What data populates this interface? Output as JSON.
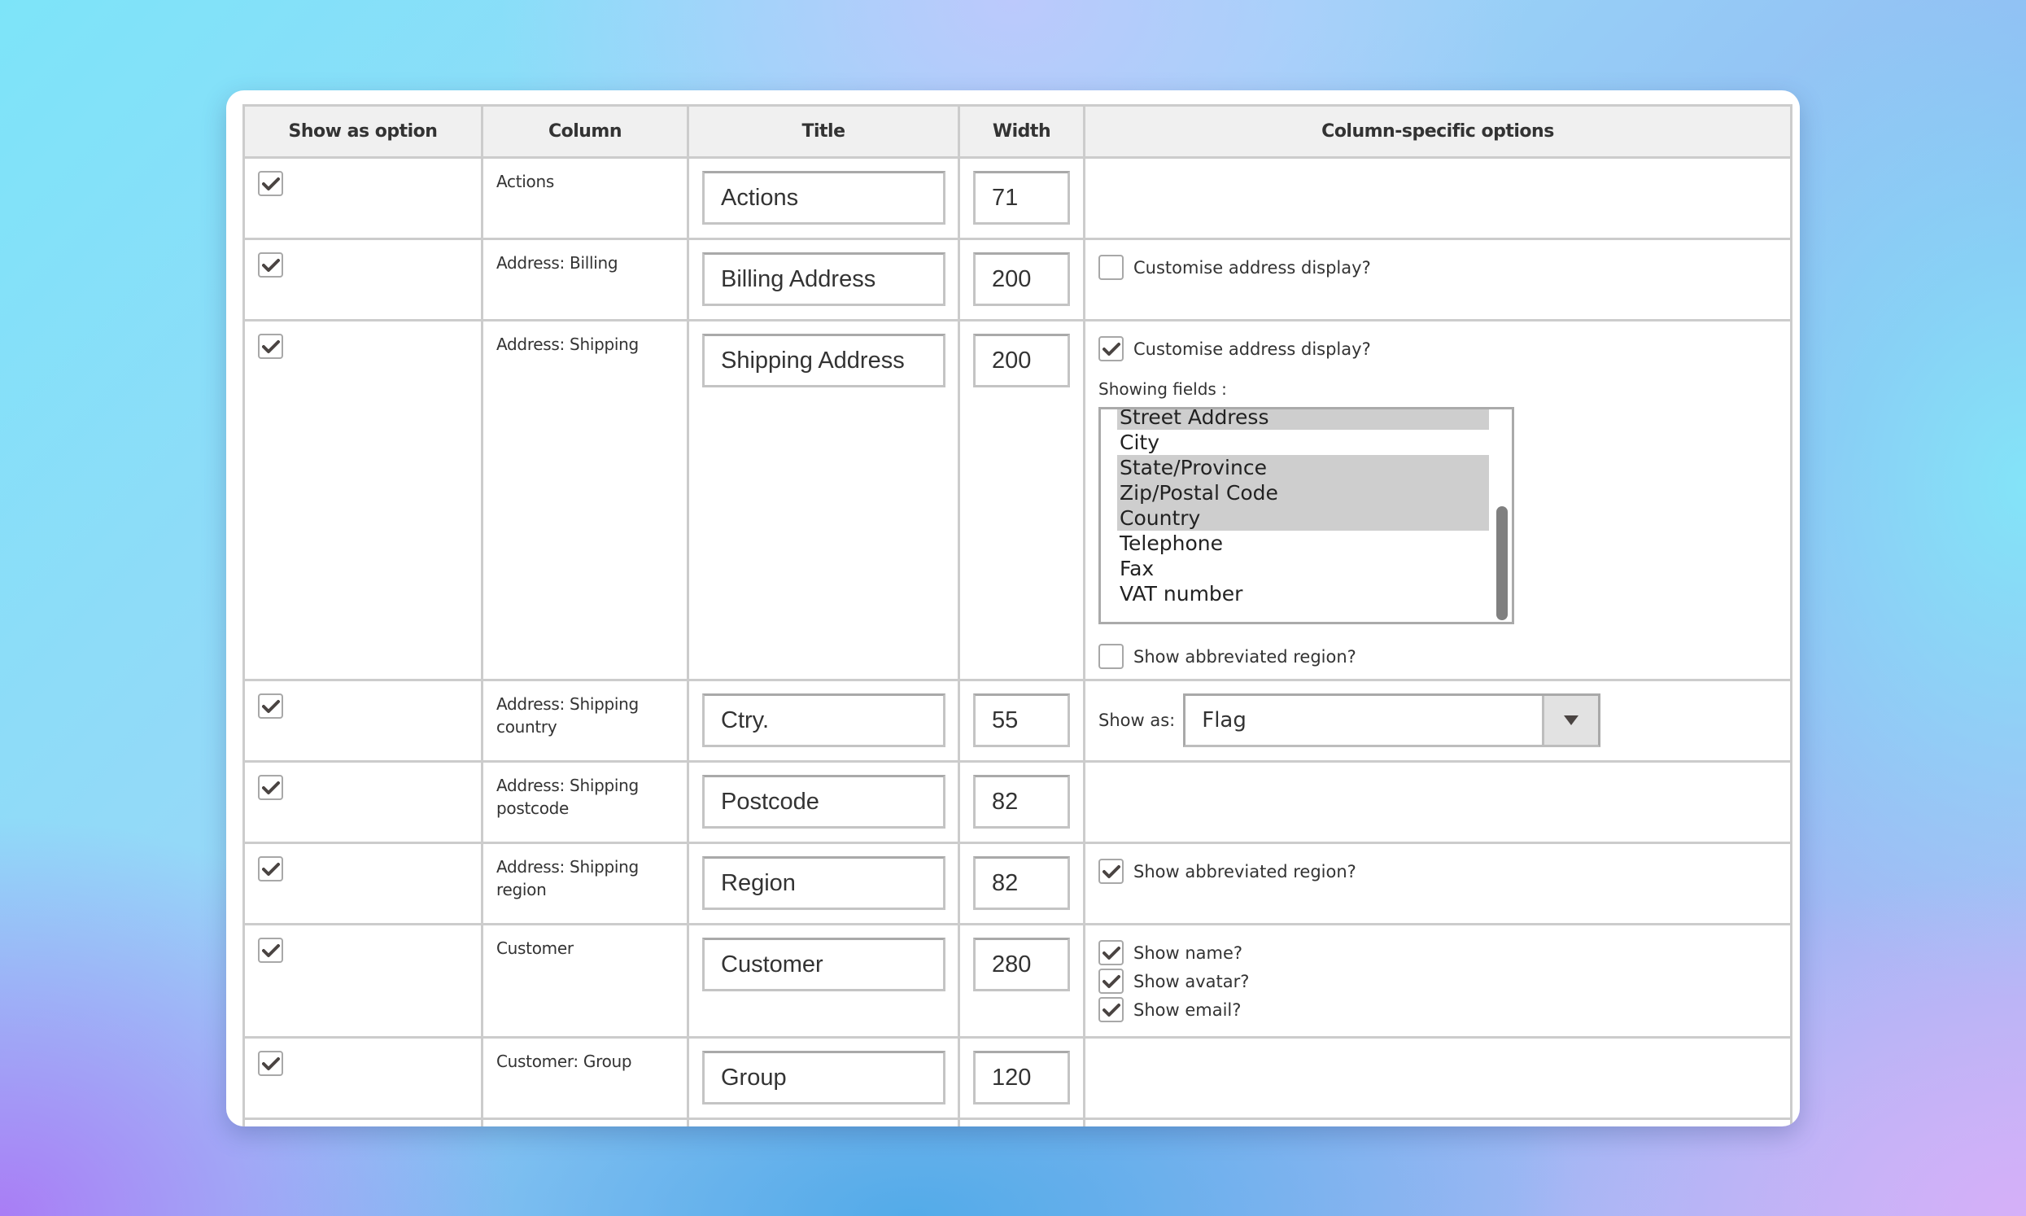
{
  "table": {
    "headers": {
      "show_as_option": "Show as option",
      "column": "Column",
      "title": "Title",
      "width": "Width",
      "options": "Column-specific options"
    },
    "rows": [
      {
        "show_as_option": true,
        "column": "Actions",
        "title": "Actions",
        "width": "71"
      },
      {
        "show_as_option": true,
        "column": "Address: Billing",
        "title": "Billing Address",
        "width": "200",
        "options": {
          "customise_label": "Customise address display?",
          "customise_checked": false
        }
      },
      {
        "show_as_option": true,
        "column": "Address: Shipping",
        "title": "Shipping Address",
        "width": "200",
        "options": {
          "customise_label": "Customise address display?",
          "customise_checked": true,
          "showing_fields_label": "Showing fields :",
          "fields": [
            {
              "label": "Street Address",
              "selected": true
            },
            {
              "label": "City",
              "selected": false
            },
            {
              "label": "State/Province",
              "selected": true
            },
            {
              "label": "Zip/Postal Code",
              "selected": true
            },
            {
              "label": "Country",
              "selected": true
            },
            {
              "label": "Telephone",
              "selected": false
            },
            {
              "label": "Fax",
              "selected": false
            },
            {
              "label": "VAT number",
              "selected": false
            }
          ],
          "abbreviated_label": "Show abbreviated region?",
          "abbreviated_checked": false
        }
      },
      {
        "show_as_option": true,
        "column": "Address: Shipping country",
        "title": "Ctry.",
        "width": "55",
        "options": {
          "show_as_label": "Show as:",
          "show_as_value": "Flag"
        }
      },
      {
        "show_as_option": true,
        "column": "Address: Shipping postcode",
        "title": "Postcode",
        "width": "82"
      },
      {
        "show_as_option": true,
        "column": "Address: Shipping region",
        "title": "Region",
        "width": "82",
        "options": {
          "abbreviated_label": "Show abbreviated region?",
          "abbreviated_checked": true
        }
      },
      {
        "show_as_option": true,
        "column": "Customer",
        "title": "Customer",
        "width": "280",
        "options": {
          "show_name_label": "Show name?",
          "show_name_checked": true,
          "show_avatar_label": "Show avatar?",
          "show_avatar_checked": true,
          "show_email_label": "Show email?",
          "show_email_checked": true
        }
      },
      {
        "show_as_option": true,
        "column": "Customer: Group",
        "title": "Group",
        "width": "120"
      }
    ]
  }
}
